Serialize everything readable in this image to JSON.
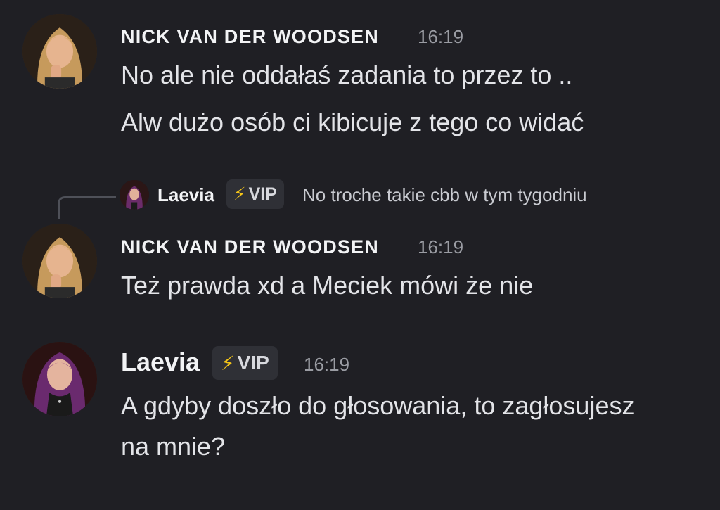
{
  "messages": {
    "m1": {
      "author": "NICK VAN DER WOODSEN",
      "time": "16:19",
      "lines": [
        "No ale nie oddałaś zadania to przez to ..",
        "Alw dużo osób ci kibicuje z tego co widać"
      ]
    },
    "reply": {
      "author": "Laevia",
      "badge": "VIP",
      "badge_icon": "⚡",
      "text": "No troche takie cbb w tym tygodniu"
    },
    "m2": {
      "author": "NICK VAN DER WOODSEN",
      "time": "16:19",
      "lines": [
        "Też prawda xd a Meciek mówi że nie"
      ]
    },
    "m3": {
      "author": "Laevia",
      "badge": "VIP",
      "badge_icon": "⚡",
      "time": "16:19",
      "lines": [
        "A gdyby doszło do głosowania, to zagłosujesz",
        "na mnie?"
      ]
    }
  },
  "colors": {
    "background": "#1f1f24",
    "badge_bg": "#2f3036",
    "bolt": "#f5c518",
    "timestamp": "#9a9ca3"
  }
}
